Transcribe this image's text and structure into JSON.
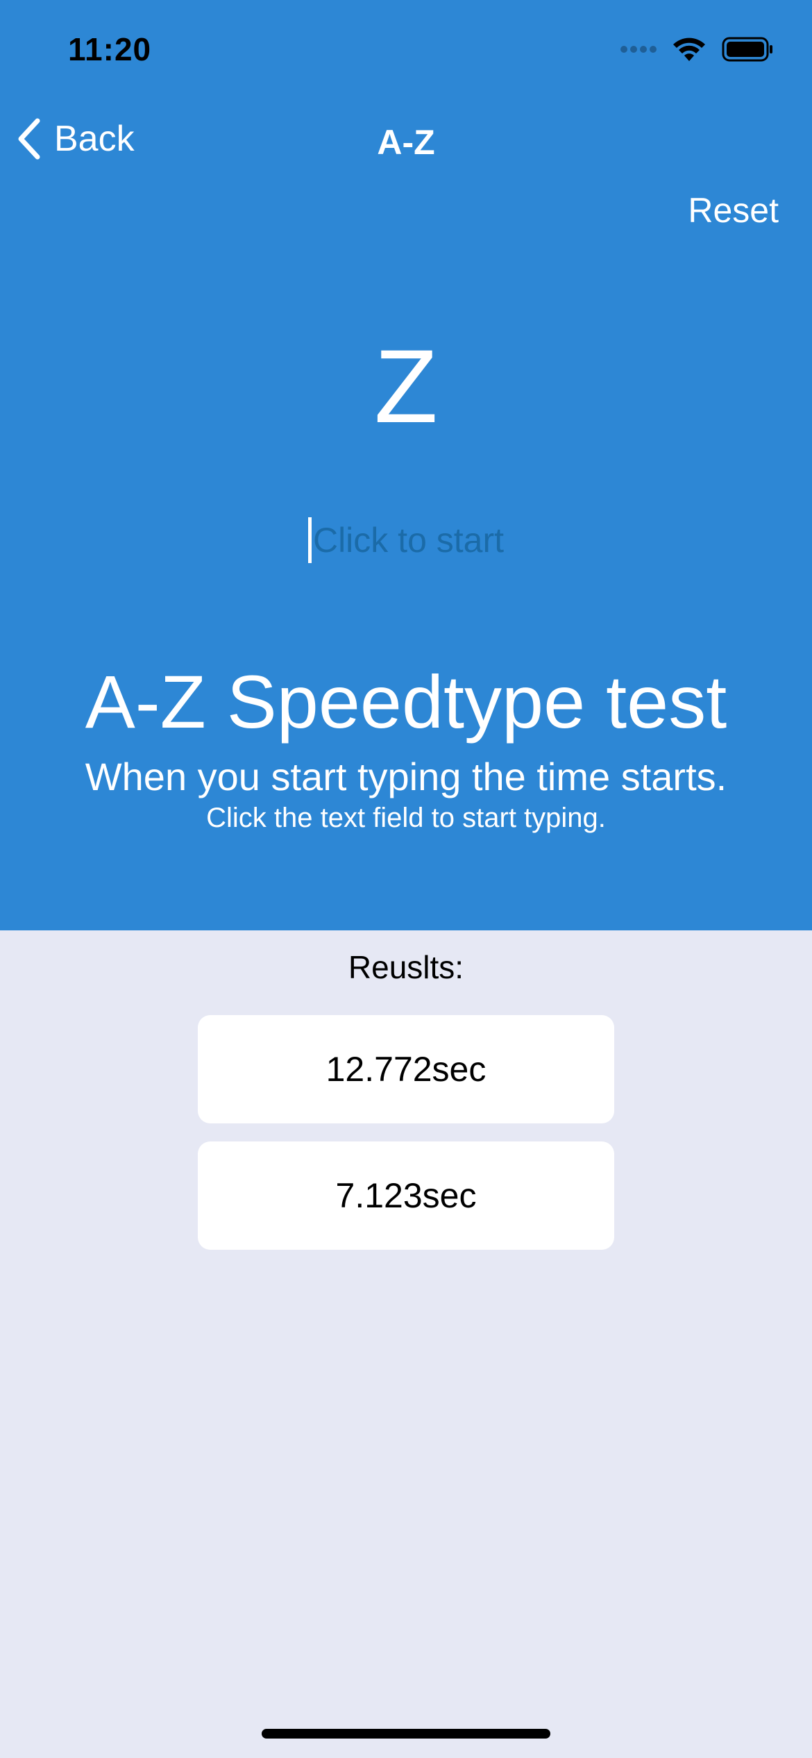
{
  "status_bar": {
    "time": "11:20"
  },
  "nav": {
    "back_label": "Back",
    "title": "A-Z",
    "reset_label": "Reset"
  },
  "game": {
    "current_letter": "Z",
    "input_placeholder": "Click to start",
    "heading": "A-Z Speedtype test",
    "subheading": "When you start typing the time starts.",
    "hint": "Click the text field to start typing."
  },
  "results": {
    "label": "Reuslts:",
    "items": [
      {
        "value": "12.772sec"
      },
      {
        "value": "7.123sec"
      }
    ]
  },
  "colors": {
    "header_blue": "#2D87D5",
    "background": "#E6E8F4",
    "card": "#FFFFFF"
  },
  "icons": [
    "cellular-signal-icon",
    "wifi-icon",
    "battery-icon",
    "chevron-left-icon"
  ]
}
